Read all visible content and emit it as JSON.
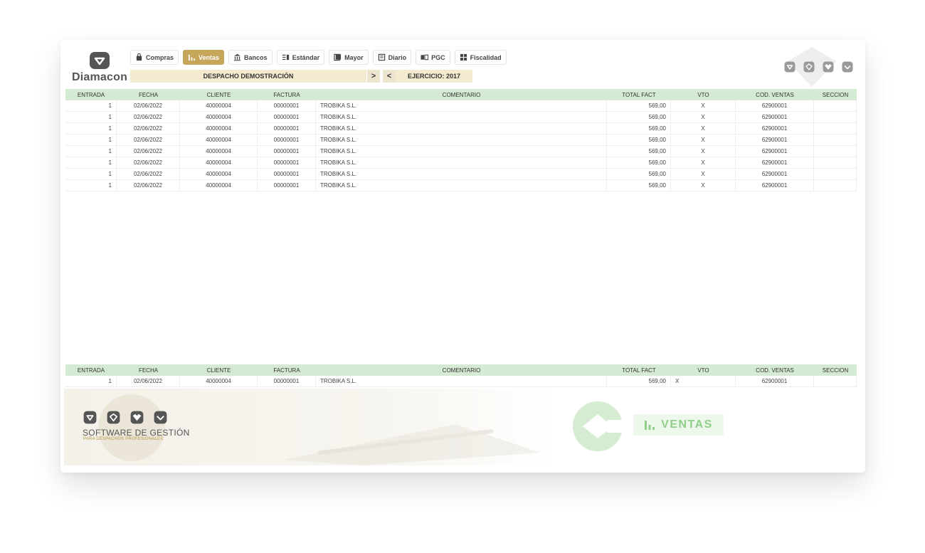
{
  "app": {
    "name": "Diamacon"
  },
  "nav": [
    {
      "label": "Compras",
      "icon": "bag-icon",
      "active": false
    },
    {
      "label": "Ventas",
      "icon": "bar-chart-icon",
      "active": true
    },
    {
      "label": "Bancos",
      "icon": "bank-icon",
      "active": false
    },
    {
      "label": "Estándar",
      "icon": "list-icon",
      "active": false
    },
    {
      "label": "Mayor",
      "icon": "book-icon",
      "active": false
    },
    {
      "label": "Diario",
      "icon": "journal-icon",
      "active": false
    },
    {
      "label": "PGC",
      "icon": "open-book-icon",
      "active": false
    },
    {
      "label": "Fiscalidad",
      "icon": "grid-icon",
      "active": false
    }
  ],
  "despacho": "DESPACHO DEMOSTRACIÓN",
  "ejercicio": "EJERCICIO: 2017",
  "arrows": {
    "next": ">",
    "prev": "<"
  },
  "columns": [
    "ENTRADA",
    "FECHA",
    "CLIENTE",
    "FACTURA",
    "COMENTARIO",
    "TOTAL FACT",
    "VTO",
    "COD. VENTAS",
    "SECCION"
  ],
  "rows": [
    {
      "entrada": "1",
      "fecha": "02/06/2022",
      "cliente": "40000004",
      "factura": "00000001",
      "comentario": "TROBIKA S.L.",
      "total": "569,00",
      "vto": "X",
      "cod": "62900001",
      "seccion": ""
    },
    {
      "entrada": "1",
      "fecha": "02/06/2022",
      "cliente": "40000004",
      "factura": "00000001",
      "comentario": "TROBIKA S.L.",
      "total": "569,00",
      "vto": "X",
      "cod": "62900001",
      "seccion": ""
    },
    {
      "entrada": "1",
      "fecha": "02/06/2022",
      "cliente": "40000004",
      "factura": "00000001",
      "comentario": "TROBIKA S.L.",
      "total": "569,00",
      "vto": "X",
      "cod": "62900001",
      "seccion": ""
    },
    {
      "entrada": "1",
      "fecha": "02/06/2022",
      "cliente": "40000004",
      "factura": "00000001",
      "comentario": "TROBIKA S.L.",
      "total": "569,00",
      "vto": "X",
      "cod": "62900001",
      "seccion": ""
    },
    {
      "entrada": "1",
      "fecha": "02/06/2022",
      "cliente": "40000004",
      "factura": "00000001",
      "comentario": "TROBIKA S.L.",
      "total": "569,00",
      "vto": "X",
      "cod": "62900001",
      "seccion": ""
    },
    {
      "entrada": "1",
      "fecha": "02/06/2022",
      "cliente": "40000004",
      "factura": "00000001",
      "comentario": "TROBIKA S.L.",
      "total": "569,00",
      "vto": "X",
      "cod": "62900001",
      "seccion": ""
    },
    {
      "entrada": "1",
      "fecha": "02/06/2022",
      "cliente": "40000004",
      "factura": "00000001",
      "comentario": "TROBIKA S.L.",
      "total": "569,00",
      "vto": "X",
      "cod": "62900001",
      "seccion": ""
    },
    {
      "entrada": "1",
      "fecha": "02/06/2022",
      "cliente": "40000004",
      "factura": "00000001",
      "comentario": "TROBIKA S.L.",
      "total": "569,00",
      "vto": "X",
      "cod": "62900001",
      "seccion": ""
    }
  ],
  "bottom_row": {
    "entrada": "1",
    "fecha": "02/06/2022",
    "cliente": "40000004",
    "factura": "00000001",
    "comentario": "TROBIKA S.L.",
    "total": "569,00",
    "vto": "X",
    "cod": "62900001",
    "seccion": ""
  },
  "footer": {
    "software": "SOFTWARE DE GESTIÓN",
    "subtitle": "PARA DESPACHOS PROFESIONALES",
    "badge": "VENTAS"
  },
  "colors": {
    "accent": "#c6a65a",
    "header_green": "#d5ead2",
    "badge_green": "#8fcf89",
    "logo_green": "#d6ecd2"
  }
}
